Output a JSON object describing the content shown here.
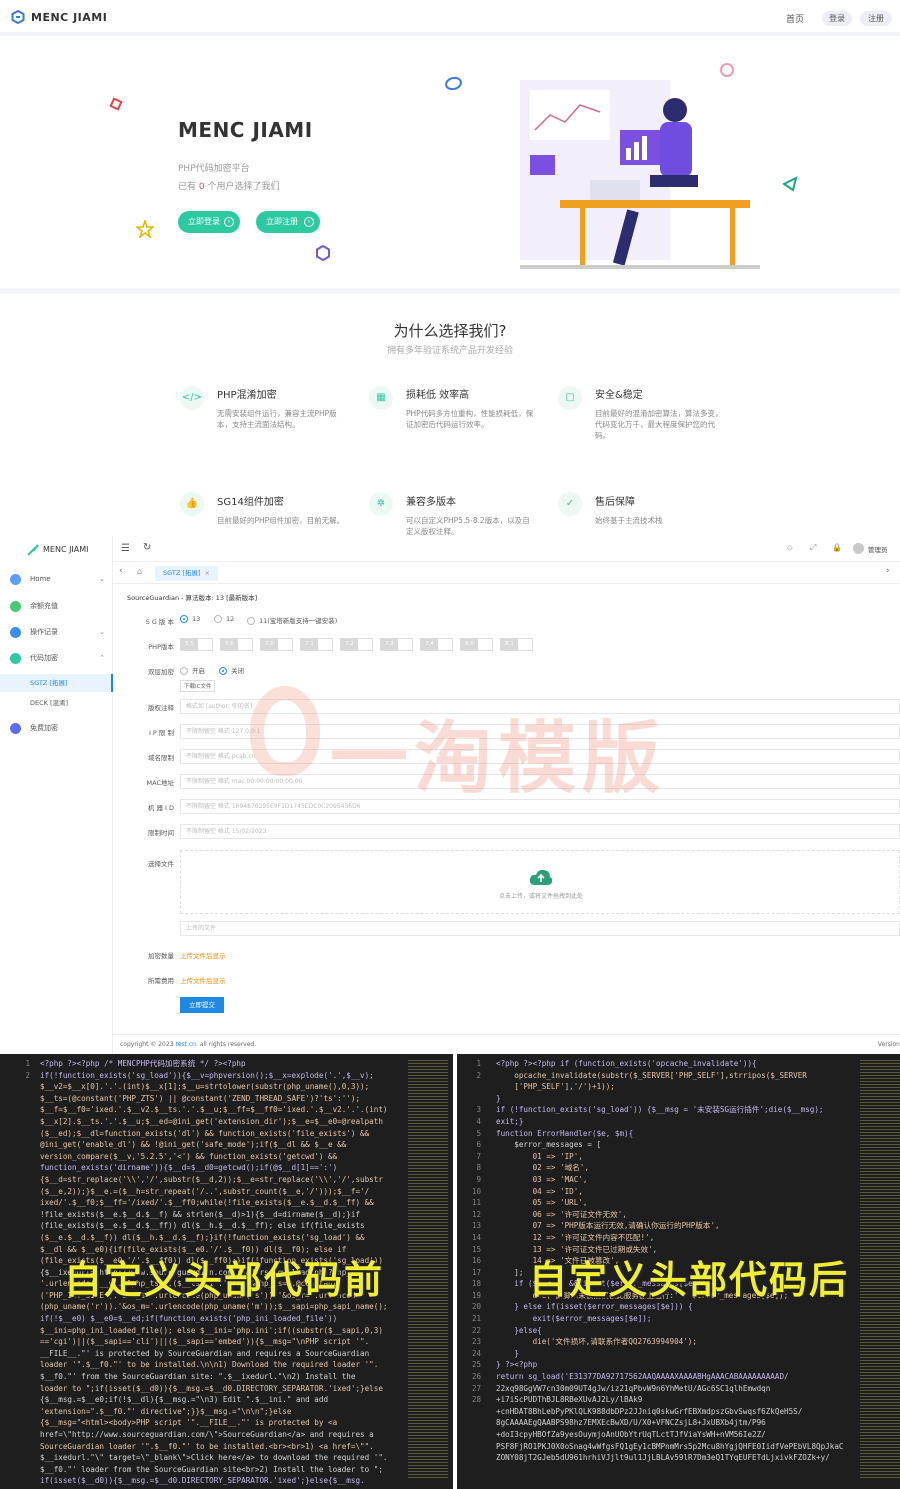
{
  "landing": {
    "brand": "MENC JIAMI",
    "nav": {
      "home": "首页",
      "login": "登录",
      "register": "注册"
    },
    "hero": {
      "title": "MENC JIAMI",
      "subtitle": "PHP代码加密平台",
      "count_prefix": "已有",
      "count_value": "0",
      "count_suffix": "个用户选择了我们",
      "login_button": "立即登录",
      "register_button": "立即注册"
    },
    "why": {
      "title": "为什么选择我们?",
      "subtitle": "拥有多年验证系统产品开发经验",
      "features": [
        {
          "icon": "code-icon",
          "title": "PHP混淆加密",
          "desc": "无需安装组件运行，兼容主流PHP版本，支持主流面法结构。"
        },
        {
          "icon": "performance-icon",
          "title": "损耗低 效率高",
          "desc": "PHP代码多方位重构，性能损耗低，保证加密后代码运行效率。"
        },
        {
          "icon": "shield-icon",
          "title": "安全&稳定",
          "desc": "目前最好的混淆加密算法，算法多变，代码变化万千，最大程度保护您的代码。"
        },
        {
          "icon": "thumbs-up-icon",
          "title": "SG14组件加密",
          "desc": "目前最好的PHP组件加密，目前无解。"
        },
        {
          "icon": "compat-icon",
          "title": "兼容多版本",
          "desc": "可以自定义PHP5.5-8.2版本，以及自定义版权注释。"
        },
        {
          "icon": "support-icon",
          "title": "售后保障",
          "desc": "始终基于主流技术栈"
        }
      ]
    }
  },
  "admin": {
    "brand": "MENC JIAMI",
    "user": "管理员",
    "sidebar": [
      {
        "label": "Home",
        "color": "#5b9df9",
        "arrow": "⌄"
      },
      {
        "label": "余额充值",
        "color": "#48c774",
        "arrow": ""
      },
      {
        "label": "操作记录",
        "color": "#3a8ee6",
        "arrow": "⌄"
      },
      {
        "label": "代码加密",
        "color": "#2dc9a0",
        "arrow": "⌃"
      }
    ],
    "sub_items": [
      "SGTZ [拓展]",
      "DECK [混淆]"
    ],
    "extra_item": {
      "label": "免费加密",
      "color": "#5b6cf9"
    },
    "tab": "SGTZ [拓展]",
    "form": {
      "heading": "SourceGuardian - 算法版本: 13 [最新版本]",
      "sg_label": "S G 版 本",
      "sg_options": [
        "13",
        "12",
        "11(宝塔新版支持一键安装)"
      ],
      "php_label": "PHP版本",
      "php_versions": [
        "5.5",
        "5.6",
        "7.0",
        "7.1",
        "7.2",
        "7.3",
        "7.4",
        "8.0",
        "8.1"
      ],
      "dual_label": "双层加密",
      "dual_options": [
        "开启",
        "关闭"
      ],
      "download_ic": "下载IC文件",
      "fields": [
        {
          "label": "版权注释",
          "placeholder": "格式如 [author: 你的名]"
        },
        {
          "label": "I P 限 制",
          "placeholder": "不限制留空 格式 127.0.0.1"
        },
        {
          "label": "域名限制",
          "placeholder": "不限制留空 格式 pcab.cn"
        },
        {
          "label": "MAC地址",
          "placeholder": "不限制留空 格式 mac 00:00:00:00:00:00"
        },
        {
          "label": "机 器 I D",
          "placeholder": "不限制留空 格式 1694876295E9F1D1745EDC0C2095436D6"
        },
        {
          "label": "限制时间",
          "placeholder": "不限制留空 格式 15/02/2023"
        }
      ],
      "file_label": "选择文件",
      "upload_hint": "点击上传，或将文件拖拽到此处",
      "upload_input": "上传的文件",
      "count_label": "加密数量",
      "count_value": "上传文件后显示",
      "cost_label": "所需费用",
      "cost_value": "上传文件后显示",
      "submit": "立即提交"
    },
    "footer_copyright": "copyright © 2023",
    "footer_link": "test.cn.",
    "footer_rights": "all rights reserved.",
    "footer_version": "Version",
    "watermark": "一淘模版"
  },
  "code": {
    "left_caption": "自定义头部代码前",
    "right_caption": "自定义头部代码后",
    "left_lines": [
      "<?php ?><?php /* MENCPHP代码加密系统 */ ?><?php",
      "if(!function_exists('sg_load')){$__v=phpversion();$__x=explode('.',$__v);",
      "$__v2=$__x[0].'.'.(int)$__x[1];$__u=strtolower(substr(php_uname(),0,3));",
      "$__ts=(@constant('PHP_ZTS') || @constant('ZEND_THREAD_SAFE')?'ts':'');",
      "$__f=$__f0='ixed.'.$__v2.$__ts.'.'.$__u;$__ff=$__ff0='ixed.'.$__v2.'.'.(int)",
      "$__x[2].$__ts.'.'.$__u;$__ed=@ini_get('extension_dir');$__e=$__e0=@realpath",
      "($__ed);$__dl=function_exists('dl') && function_exists('file_exists') &&",
      "@ini_get('enable_dl') && !@ini_get('safe_mode');if($__dl && $__e &&",
      "version_compare($__v,'5.2.5','<') && function_exists('getcwd') &&",
      "function_exists('dirname')){$__d=$__d0=getcwd();if(@$__d[1]==':')",
      "{$__d=str_replace('\\\\','/',substr($__d,2));$__e=str_replace('\\\\','/',substr",
      "($__e,2));}$__e.=($__h=str_repeat('/..',substr_count($__e,'/')));$__f='/",
      "ixed/'.$__f0;$__ff='/ixed/'.$__ff0;while(!file_exists($__e.$__d.$__ff) &&",
      "!file_exists($__e.$__d.$__f) && strlen($__d)>1){$__d=dirname($__d);}if",
      "(file_exists($__e.$__d.$__ff)) dl($__h.$__d.$__ff); else if(file_exists",
      "($__e.$__d.$__f)) dl($__h.$__d.$__f);}if(!function_exists('sg_load') &&",
      "$__dl && $__e0){if(file_exists($__e0.'/'.$__f0)) dl($__f0); else if",
      "(file_exists($__e0.'/'.$__ff0)) dl($__ff0);}if(!function_exists('sg_load'))",
      "{$__ixedurl='http://www.sourceguardian.com/loaders/download.php?php_v=",
      "'.urlencode($__v).'&php_ts='.($__ts?'1':'0').'&php_is='.@constant",
      "('PHP_INT_SIZE').'&os_s='.urlencode(php_uname('s')).'&os_r='.urlencode",
      "(php_uname('r')).'&os_m='.urlencode(php_uname('m'));$__sapi=php_sapi_name();",
      "if(!$__e0) $__e0=$__ed;if(function_exists('php_ini_loaded_file'))",
      "$__ini=php_ini_loaded_file(); else $__ini='php.ini';if((substr($__sapi,0,3)",
      "=='cgi')||($__sapi=='cli')||($__sapi=='embed')){$__msg=\"\\nPHP script '\".",
      "__FILE__.\"' is protected by SourceGuardian and requires a SourceGuardian",
      "loader '\".$__f0.\"' to be installed.\\n\\n1) Download the required loader '\".",
      "$__f0.\"' from the SourceGuardian site: \".$__ixedurl.\"\\n2) Install the",
      "loader to \";if(isset($__d0)){$__msg.=$__d0.DIRECTORY_SEPARATOR.'ixed';}else",
      "{$__msg.=$__e0;if(!$__dl){$__msg.=\"\\n3) Edit \".$__ini.\" and add",
      "'extension=\".$__f0.\"' directive\";}}$__msg.=\"\\n\\n\";}else",
      "{$__msg=\"<html><body>PHP script '\".__FILE__.\"' is protected by <a",
      "href=\\\"http://www.sourceguardian.com/\\\">SourceGuardian</a> and requires a",
      "SourceGuardian loader '\".$__f0.\"' to be installed.<br><br>1) <a href=\\\"\".",
      "$__ixedurl.\"\\\" target=\\\"_blank\\\">Click here</a> to download the required '\".",
      "$__f0.\"' loader from the SourceGuardian site<br>2) Install the loader to \";",
      "if(isset($__d0)){$__msg.=$__d0.DIRECTORY_SEPARATOR.'ixed';}else{$__msg."
    ],
    "left_numbers": [
      "1",
      "2",
      "",
      "",
      "",
      "",
      "",
      "",
      "",
      "",
      "",
      "",
      "",
      "",
      "",
      "",
      "",
      "",
      "",
      "",
      "",
      "",
      "",
      "",
      "",
      "",
      "",
      "",
      "",
      "",
      "",
      "",
      "",
      "",
      "",
      "",
      ""
    ],
    "right_lines": [
      "<?php ?><?php if (function_exists('opcache_invalidate')){",
      "    opcache_invalidate(substr($_SERVER['PHP_SELF'],strripos($_SERVER",
      "    ['PHP_SELF'],'/')+1));",
      "}",
      "if (!function_exists('sg_load')) {$__msg = '未安装SG运行插件';die($__msg);",
      "exit;}",
      "",
      "function ErrorHandler($e, $m){",
      "    $error_messages = [",
      "        01 => 'IP',",
      "        02 => '域名',",
      "        03 => 'MAC',",
      "        04 => 'ID',",
      "        05 => 'URL',",
      "        06 => '许可证文件无效',",
      "        07 => 'PHP版本运行无效,请确认你运行的PHP版本',",
      "        12 => '许可证文件内容不匹配!',",
      "        13 => '许可证文件已过期或失效',",
      "        14 => '文件已被篡改',",
      "    ];",
      "",
      "    if ($e <= 5 && isset($error_messages[$e])) {",
      "        die('此脚本未被授权在此服务器上运行:' . $error_messages[$e]);",
      "    } else if(isset($error_messages[$e])) {",
      "        exit($error_messages[$e]);",
      "    }else{",
      "        die('文件损坏,请联系作者QQ2763994904');",
      "    }",
      "} ?><?php",
      "return sg_load('E31377DA92717562AAQAAAAXAAAABHgAAACABAAAAAAAAAD/",
      "22xq98GgVW7cn30m09UT4gJw/iz21qPbvW9n6YhMetU/AGc6SC1qlhEmwdqn",
      "+i7iScPUDThBJL8RBeXUvAJ2Ly/lBAk9",
      "+cnHDAT8BhLebPyPKlQLK988dbDPz2JJniq0skwGrfEBXmdpszGbvSwqsf6ZkQeH5S/",
      "8gCAAAAEgQAABPS98hz7EMXEcBwXD/U/X0+VFNCZsjL8+JxUBXb4jtm/P96",
      "+doI3cpyHBOfZa9yesOuymjoAnUObYtrUqTLctTJfViaYsWH+nVM56Ie2Z/",
      "PSF8FjRO1PKJ0X0oSnag4wWfgsFQ1gEy1cBMPnmMrs5p2Mcu8hYgjQHFE0IidfVePEbVL8QpJkaC",
      "ZONY08jT2GJeb5dU961hrhiVJjlt9ul1JjLBLAv59lR7Dm3eQ1TYqEUFETdLjxivkFZOZk+y/"
    ],
    "right_numbers": [
      "1",
      "2",
      "",
      "",
      "3",
      "4",
      "5",
      "6",
      "7",
      "8",
      "9",
      "10",
      "11",
      "12",
      "13",
      "14",
      "15",
      "16",
      "17",
      "18",
      "19",
      "20",
      "21",
      "22",
      "23",
      "24",
      "25",
      "26",
      "27",
      "28",
      "",
      "",
      "",
      "",
      "",
      "",
      ""
    ]
  }
}
